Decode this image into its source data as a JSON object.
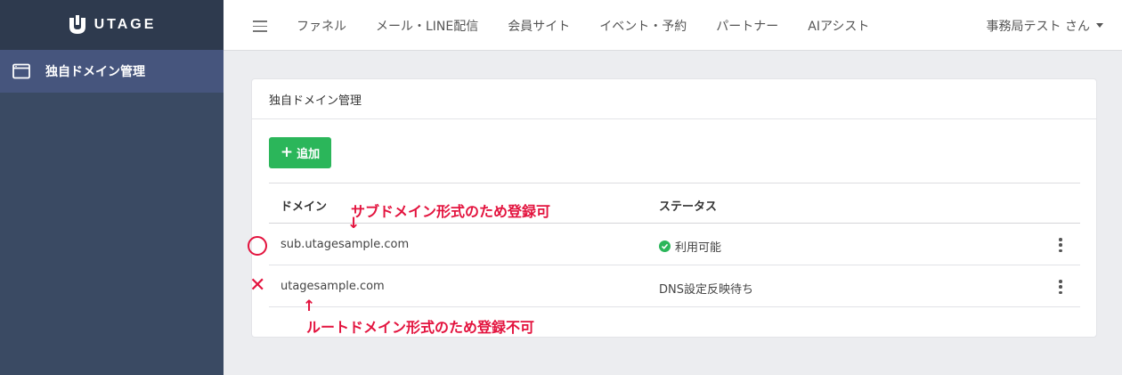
{
  "brand": {
    "name": "UTAGE"
  },
  "sidebar": {
    "items": [
      {
        "label": "独自ドメイン管理",
        "icon": "browser-window-icon"
      }
    ]
  },
  "header": {
    "nav": [
      "ファネル",
      "メール・LINE配信",
      "会員サイト",
      "イベント・予約",
      "パートナー",
      "AIアシスト"
    ],
    "user": "事務局テスト さん"
  },
  "card": {
    "title": "独自ドメイン管理",
    "add_label": "追加"
  },
  "table": {
    "headers": {
      "domain": "ドメイン",
      "status": "ステータス"
    },
    "rows": [
      {
        "domain": "sub.utagesample.com",
        "status": "利用可能",
        "status_ok": true
      },
      {
        "domain": "utagesample.com",
        "status": "DNS設定反映待ち",
        "status_ok": false
      }
    ]
  },
  "annotations": {
    "sub_note": "サブドメイン形式のため登録可",
    "root_note": "ルートドメイン形式のため登録不可",
    "down_arrow": "↓",
    "up_arrow": "↑",
    "ok_mark": "○",
    "ng_mark": "✕"
  },
  "colors": {
    "sidebar": "#3a4a63",
    "sidebar_active": "#46557d",
    "brand_bar": "#2e3a4e",
    "accent_green": "#2bb65a",
    "annotation_red": "#e3133e"
  }
}
